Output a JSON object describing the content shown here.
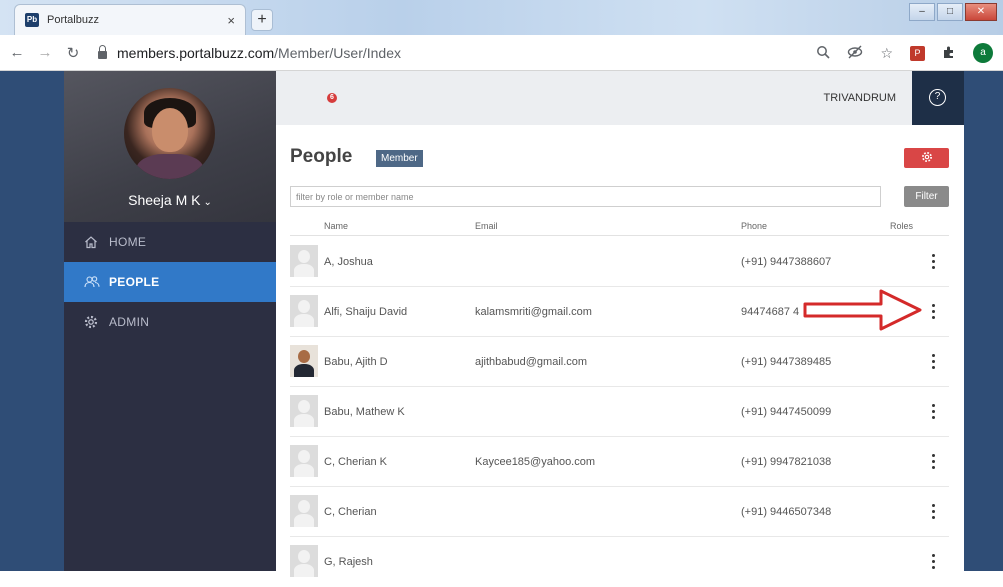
{
  "browser": {
    "tab_title": "Portalbuzz",
    "tab_favicon_text": "Pb",
    "tab_close": "×",
    "new_tab": "+",
    "url_host": "members.portalbuzz.com",
    "url_path": "/Member/User/Index",
    "profile_initial": "a"
  },
  "sidebar": {
    "user_name": "Sheeja M K",
    "nav": [
      {
        "label": "HOME",
        "icon": "home-icon"
      },
      {
        "label": "PEOPLE",
        "icon": "people-icon",
        "active": true
      },
      {
        "label": "ADMIN",
        "icon": "gear-icon"
      }
    ]
  },
  "topbar": {
    "notification_count": "6",
    "location": "TRIVANDRUM",
    "help": "?"
  },
  "main": {
    "title": "People",
    "badge": "Member",
    "filter_placeholder": "filter by role or member name",
    "filter_button": "Filter",
    "columns": {
      "name": "Name",
      "email": "Email",
      "phone": "Phone",
      "roles": "Roles"
    },
    "rows": [
      {
        "name": "A, Joshua",
        "email": "",
        "phone": "(+91) 9447388607",
        "photo": false
      },
      {
        "name": "Alfi, Shaiju David",
        "email": "kalamsmriti@gmail.com",
        "phone": "94474687 4",
        "photo": false
      },
      {
        "name": "Babu, Ajith D",
        "email": "ajithbabud@gmail.com",
        "phone": "(+91) 9447389485",
        "photo": true
      },
      {
        "name": "Babu, Mathew K",
        "email": "",
        "phone": "(+91) 9447450099",
        "photo": false
      },
      {
        "name": "C, Cherian K",
        "email": "Kaycee185@yahoo.com",
        "phone": "(+91) 9947821038",
        "photo": false
      },
      {
        "name": "C, Cherian",
        "email": "",
        "phone": "(+91) 9446507348",
        "photo": false
      },
      {
        "name": "G, Rajesh",
        "email": "",
        "phone": "",
        "photo": false
      }
    ]
  },
  "colors": {
    "sidebar_bg": "#2c2f42",
    "active_nav": "#3179c8",
    "accent_red": "#d94646",
    "annotation_arrow": "#d42a2a"
  }
}
